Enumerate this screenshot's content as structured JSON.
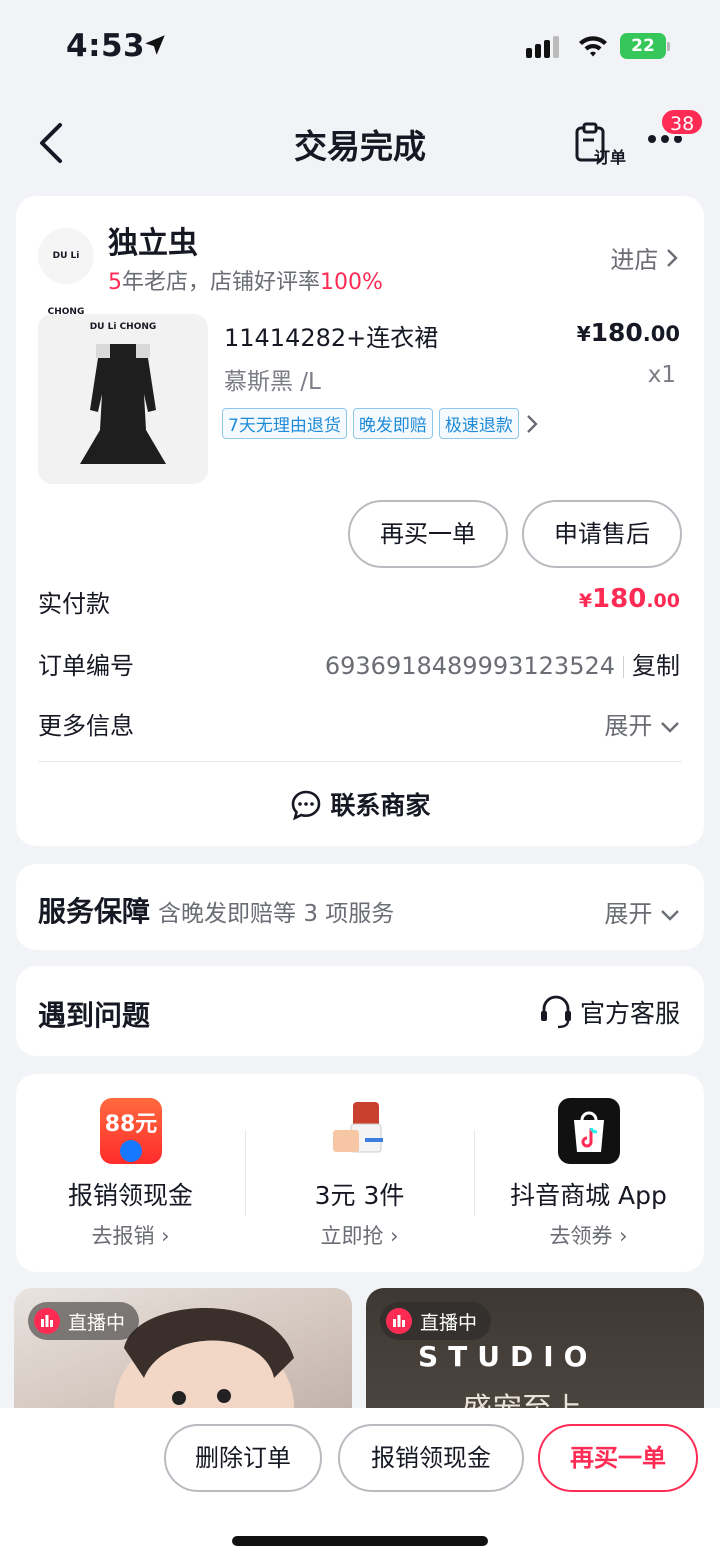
{
  "status": {
    "time": "4:53",
    "battery": "22"
  },
  "nav": {
    "title": "交易完成",
    "order_label": "订单",
    "badge": "38"
  },
  "shop": {
    "logo_text": "DU Li CHONG",
    "name": "独立虫",
    "years": "5",
    "years_suffix": "年老店，店铺好评率",
    "rating": "100%",
    "enter": "进店"
  },
  "product": {
    "brand": "DU Li CHONG",
    "title": "11414282+连衣裙",
    "price_cur": "¥",
    "price_int": "180",
    "price_dec": ".00",
    "spec": "慕斯黑 /L",
    "qty": "x1",
    "tags": [
      "7天无理由退货",
      "晚发即赔",
      "极速退款"
    ]
  },
  "actions": {
    "rebuy": "再买一单",
    "after_sale": "申请售后"
  },
  "rows": {
    "paid_label": "实付款",
    "paid_cur": "¥",
    "paid_int": "180",
    "paid_dec": ".00",
    "order_label": "订单编号",
    "order_no": "6936918489993123524",
    "copy": "复制",
    "more_label": "更多信息",
    "expand": "展开"
  },
  "contact": "联系商家",
  "service": {
    "title": "服务保障",
    "sub": "含晚发即赔等 3 项服务",
    "expand": "展开"
  },
  "problem": {
    "title": "遇到问题",
    "link": "官方客服"
  },
  "promos": [
    {
      "img_text": "88元",
      "title": "报销领现金",
      "link": "去报销"
    },
    {
      "img_text": "",
      "title": "3元 3件",
      "link": "立即抢"
    },
    {
      "img_text": "",
      "title": "抖音商城 App",
      "link": "去领券"
    }
  ],
  "feed": [
    {
      "live": "直播中"
    },
    {
      "live": "直播中",
      "title": "STUDIO",
      "sub": "盛宠至上"
    }
  ],
  "bottom": {
    "delete": "删除订单",
    "cash": "报销领现金",
    "rebuy": "再买一单"
  },
  "colors": {
    "accent": "#fe2c55",
    "tag": "#1f8bd6",
    "bg": "#f2f3f7"
  }
}
